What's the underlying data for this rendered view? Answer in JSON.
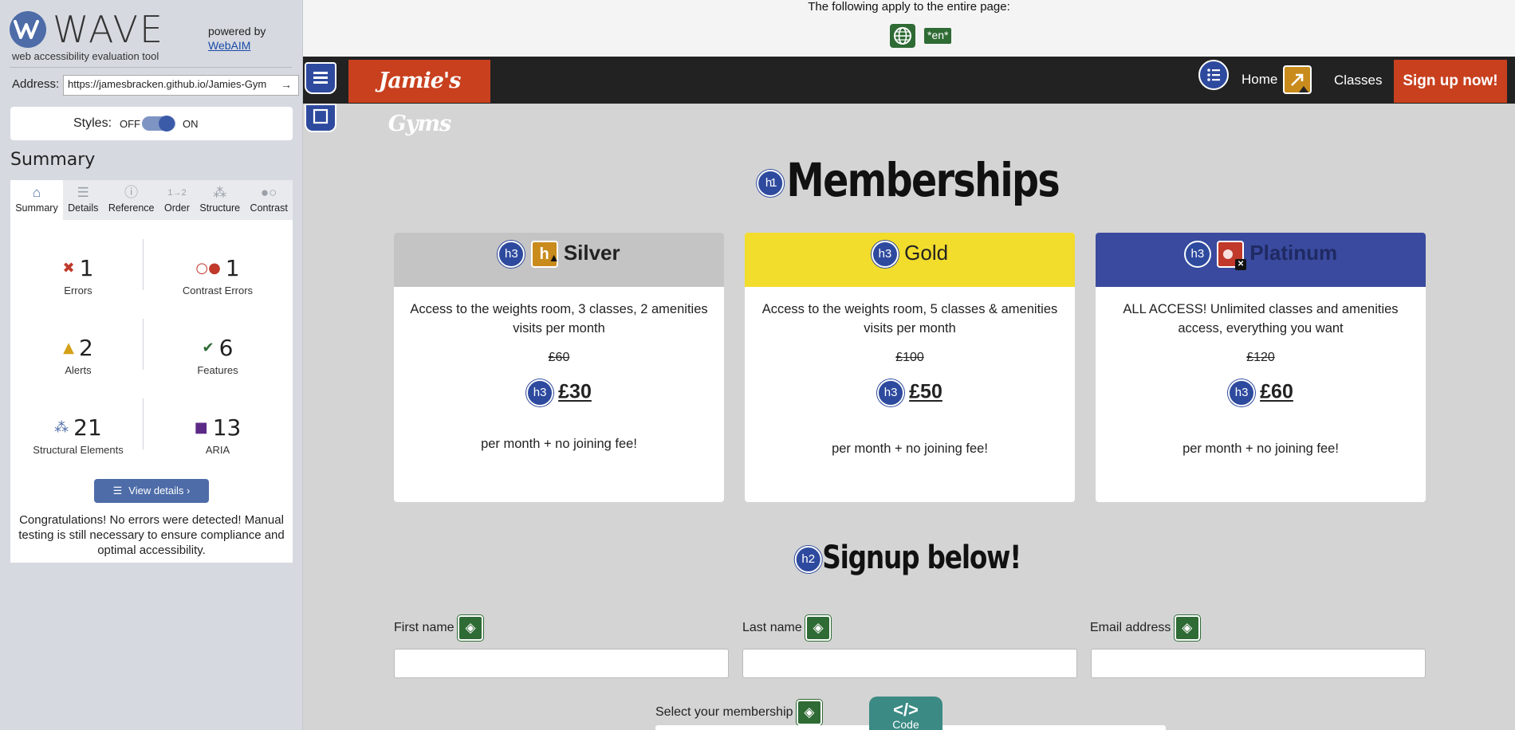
{
  "wave": {
    "brand": "WAVE",
    "tagline": "web accessibility evaluation tool",
    "powered_by": "powered by",
    "webaim": "WebAIM",
    "address_label": "Address:",
    "address_value": "https://jamesbracken.github.io/Jamies-Gym",
    "styles_label": "Styles:",
    "styles_off": "OFF",
    "styles_on": "ON",
    "summary_heading": "Summary",
    "tabs": [
      {
        "label": "Summary",
        "icon": "home-icon"
      },
      {
        "label": "Details",
        "icon": "list-icon"
      },
      {
        "label": "Reference",
        "icon": "info-icon"
      },
      {
        "label": "Order",
        "icon": "order-icon"
      },
      {
        "label": "Structure",
        "icon": "structure-icon"
      },
      {
        "label": "Contrast",
        "icon": "contrast-icon"
      }
    ],
    "stats": {
      "errors": {
        "count": "1",
        "label": "Errors"
      },
      "contrast": {
        "count": "1",
        "label": "Contrast Errors"
      },
      "alerts": {
        "count": "2",
        "label": "Alerts"
      },
      "features": {
        "count": "6",
        "label": "Features"
      },
      "structural": {
        "count": "21",
        "label": "Structural Elements"
      },
      "aria": {
        "count": "13",
        "label": "ARIA"
      }
    },
    "view_details": "View details ›",
    "congrats": "Congratulations! No errors were detected! Manual testing is still necessary to ensure compliance and optimal accessibility."
  },
  "page": {
    "applies_text": "The following apply to the entire page:",
    "lang_badge": "*en*",
    "brand": "Jamie's Gyms",
    "nav": {
      "home": "Home",
      "classes": "Classes",
      "signup": "Sign up now!"
    },
    "memberships_title": "Memberships",
    "h1_badge": "h1",
    "h2_badge": "h2",
    "h3_badge": "h3",
    "cards": [
      {
        "name": "Silver",
        "desc": "Access to the weights room, 3 classes, 2 amenities visits per month",
        "old_price": "£60",
        "price": "£30",
        "note": "per month + no joining fee!",
        "head_color": "#c4c4c4",
        "head_text": "#222222"
      },
      {
        "name": "Gold",
        "desc": "Access to the weights room, 5 classes & amenities visits per month",
        "old_price": "£100",
        "price": "£50",
        "note": "per month + no joining fee!",
        "head_color": "#f2dc2c",
        "head_text": "#222222"
      },
      {
        "name": "Platinum",
        "desc": "ALL ACCESS! Unlimited classes and amenities access, everything you want",
        "old_price": "£120",
        "price": "£60",
        "note": "per month + no joining fee!",
        "head_color": "#3a4a9e",
        "head_text": "#1f2a63"
      }
    ],
    "signup_title": "Signup below!",
    "form": {
      "first_name": "First name",
      "last_name": "Last name",
      "email": "Email address",
      "membership": "Select your membership"
    },
    "code_tab": {
      "symbol": "</>",
      "label": "Code"
    }
  },
  "colors": {
    "wave_blue": "#4d6ca8",
    "error_red": "#c0392b",
    "alert_orange": "#c98b1c",
    "feature_green": "#2f6b35",
    "brand_red": "#c8401e",
    "code_teal": "#3b8a84"
  }
}
